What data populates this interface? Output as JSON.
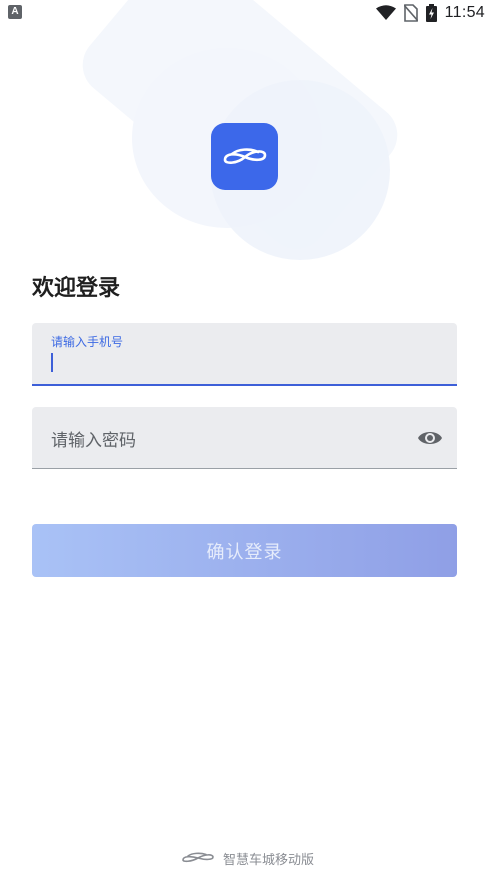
{
  "status_bar": {
    "badge": "A",
    "time": "11:54",
    "icons": [
      "wifi-icon",
      "no-sim-icon",
      "battery-charging-icon"
    ]
  },
  "logo": {
    "icon": "car-infinity-logo"
  },
  "title": "欢迎登录",
  "phone_field": {
    "label": "请输入手机号",
    "value": ""
  },
  "password_field": {
    "placeholder": "请输入密码",
    "toggle_icon": "eye-icon"
  },
  "submit_label": "确认登录",
  "footer": {
    "text": "智慧车城移动版",
    "icon": "car-outline-logo"
  },
  "colors": {
    "primary": "#3c68ea",
    "field_bg": "#ebecef",
    "button_gradient": [
      "#a9c2f6",
      "#8f9fe6"
    ]
  }
}
